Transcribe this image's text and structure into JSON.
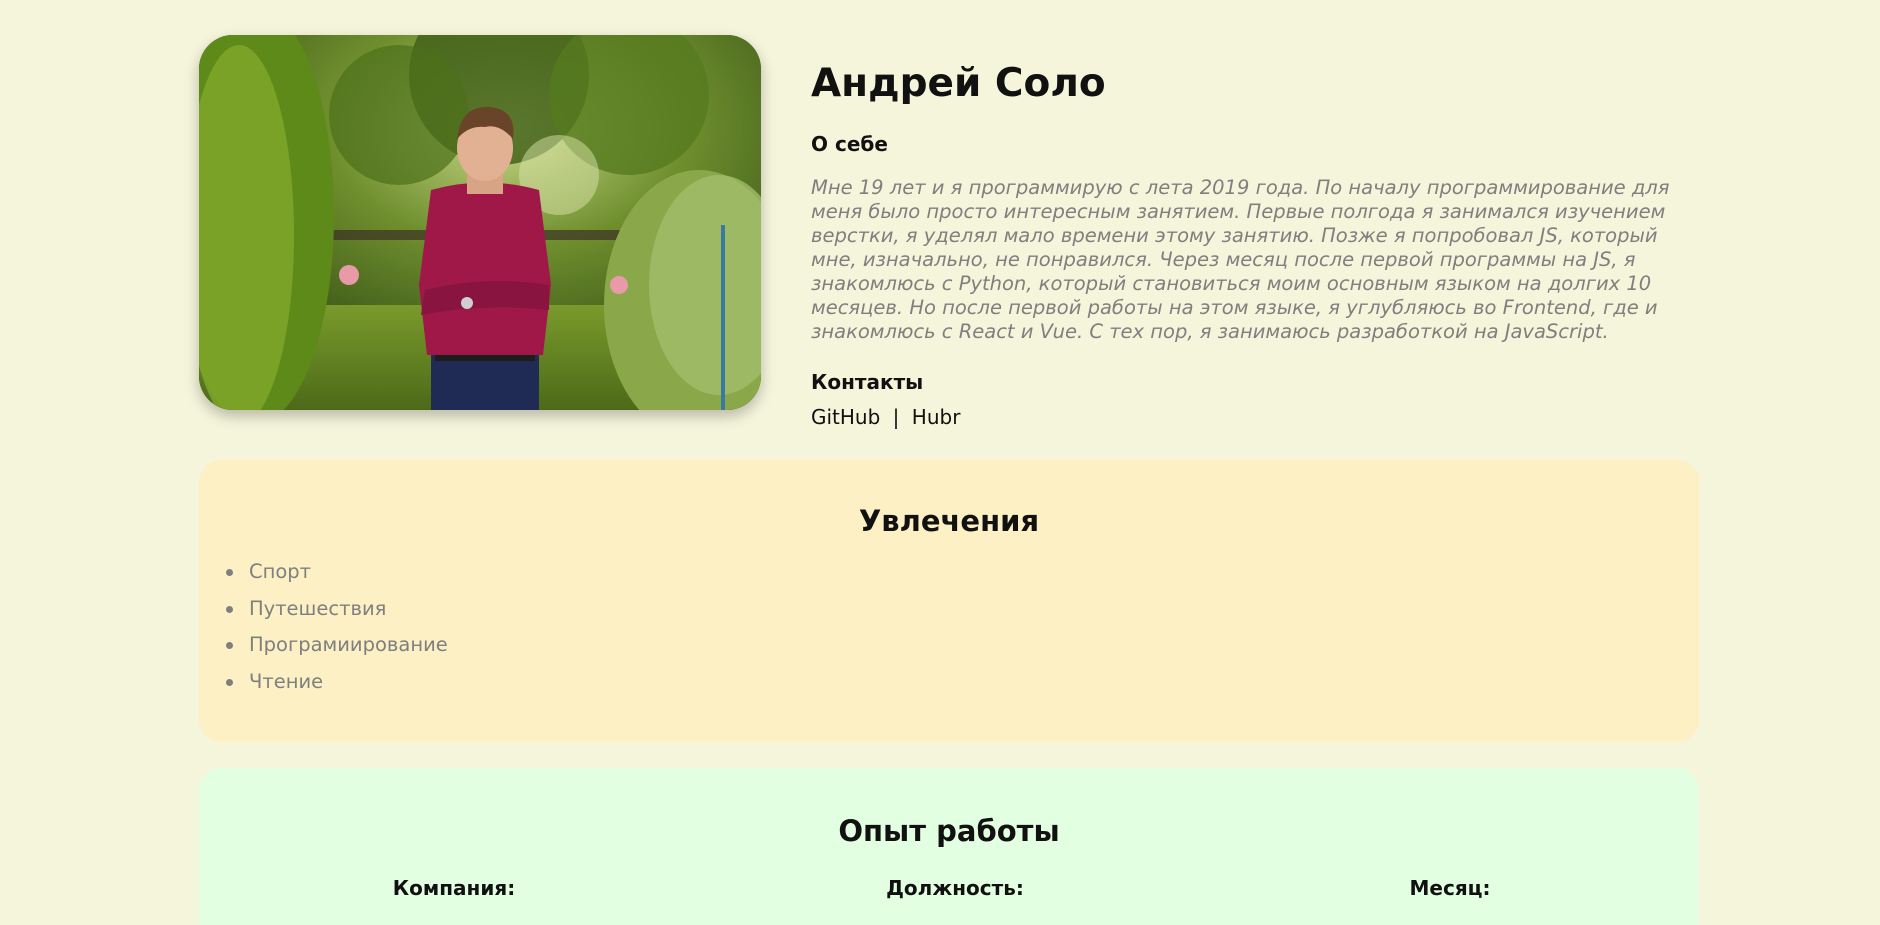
{
  "profile": {
    "name": "Андрей Соло",
    "photo_alt": "portrait-photo",
    "about_title": "О себе",
    "about_text": "Мне 19 лет и я программирую с лета 2019 года. По началу программирование для меня было просто интересным занятием. Первые полгода я занимался изучением верстки, я уделял мало времени этому занятию. Позже я попробовал JS, который мне, изначально, не понравился. Через месяц после первой программы на JS, я знакомлюсь с Python, который становиться моим основным языком на долгих 10 месяцев. Но после первой работы на этом языке, я углубляюсь во Frontend, где и знакомлюсь с React и Vue. С тех пор, я занимаюсь разработкой на JavaScript.",
    "contacts_title": "Контакты",
    "contacts": {
      "github": "GitHub",
      "separator": "|",
      "hubr": "Hubr"
    }
  },
  "hobbies": {
    "title": "Увлечения",
    "items": [
      "Спорт",
      "Путешествия",
      "Програмиирование",
      "Чтение"
    ]
  },
  "experience": {
    "title": "Опыт работы",
    "columns": [
      "Компания:",
      "Должность:",
      "Месяц:"
    ]
  },
  "colors": {
    "page_bg": "#f5f5dc",
    "hobbies_bg": "#fcf0c4",
    "experience_bg": "#e2ffe2",
    "muted_text": "#7f7f7f"
  }
}
